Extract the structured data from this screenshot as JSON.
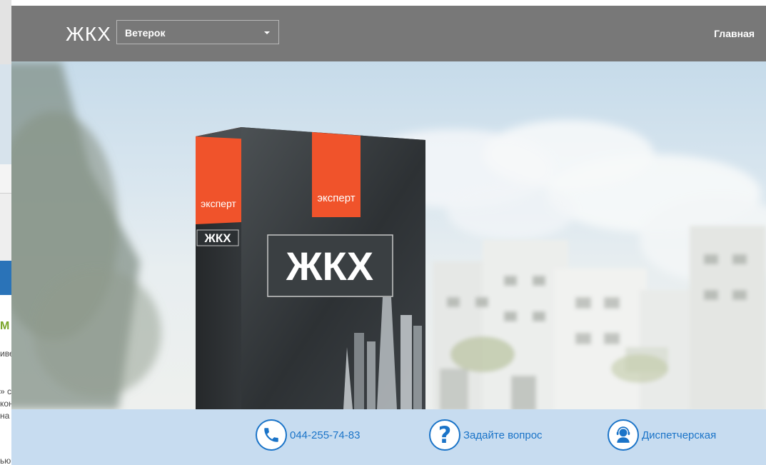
{
  "header": {
    "logo": "ЖКХ",
    "house_select": {
      "value": "Ветерок"
    },
    "nav_home": "Главная"
  },
  "hero": {
    "box_brand": "ЖКХ",
    "box_side_brand": "ЖКХ",
    "box_ribbon": "эксперт",
    "box_side_ribbon": "эксперт"
  },
  "contacts": [
    {
      "icon": "phone-icon",
      "label": "044-255-74-83"
    },
    {
      "icon": "question-icon",
      "label": "Задайте вопрос"
    },
    {
      "icon": "dispatcher-icon",
      "label": "Диспетчерская"
    }
  ],
  "background_page": {
    "fragments": [
      "М",
      "иве",
      "» с",
      "кон",
      "на",
      "ью"
    ]
  },
  "colors": {
    "header_bg": "#787878",
    "accent_orange": "#f0532b",
    "contact_blue": "#1b74c8",
    "footer_bg": "#c7dcf0"
  }
}
